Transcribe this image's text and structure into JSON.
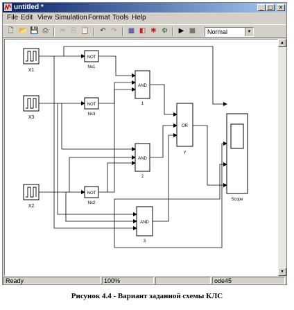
{
  "window": {
    "title": "untitled *",
    "controls": [
      "_",
      "□",
      "×"
    ]
  },
  "menu": [
    "File",
    "Edit",
    "View",
    "Simulation",
    "Format",
    "Tools",
    "Help"
  ],
  "toolbar": {
    "sim_mode": "Normal"
  },
  "diagram": {
    "sources": [
      "X1",
      "X3",
      "X2"
    ],
    "not_blocks": [
      {
        "label": "NOT",
        "name": "Nx1"
      },
      {
        "label": "NOT",
        "name": "Nx3"
      },
      {
        "label": "NOT",
        "name": "Nx2"
      }
    ],
    "and_blocks": [
      {
        "label": "AND",
        "name": "1"
      },
      {
        "label": "AND",
        "name": "2"
      },
      {
        "label": "AND",
        "name": "3"
      }
    ],
    "or_block": {
      "label": "OR",
      "name": "Y"
    },
    "scope": {
      "name": "Scope"
    }
  },
  "status": {
    "state": "Ready",
    "zoom": "100%",
    "solver": "ode45"
  },
  "caption": "Рисунок 4.4 -  Вариант заданной схемы КЛС"
}
